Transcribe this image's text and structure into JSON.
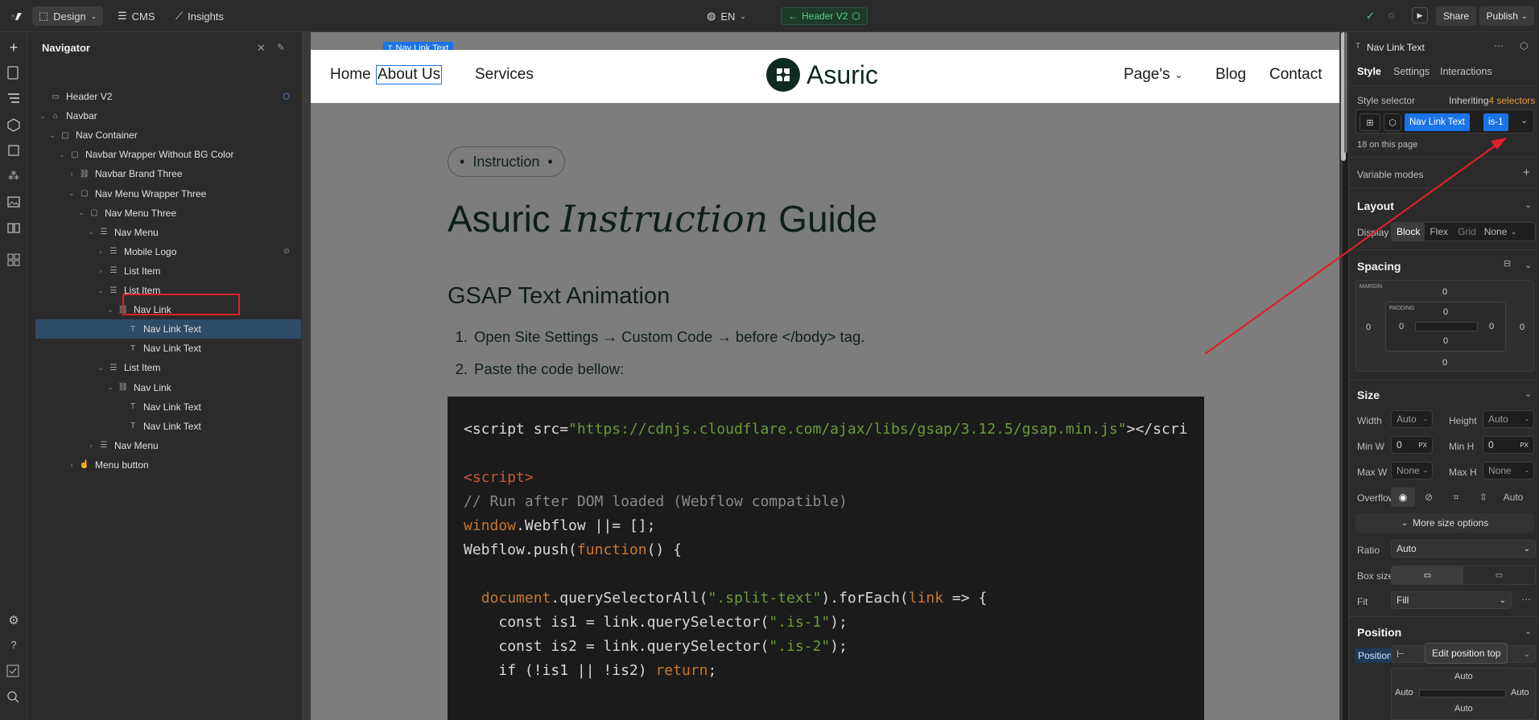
{
  "topbar": {
    "mode_tabs": [
      {
        "label": "Design",
        "active": true
      },
      {
        "label": "CMS",
        "active": false
      },
      {
        "label": "Insights",
        "active": false
      }
    ],
    "locale": "EN",
    "page_name": "Header V2",
    "share_label": "Share",
    "publish_label": "Publish"
  },
  "navigator": {
    "title": "Navigator",
    "tree": [
      {
        "label": "Header V2",
        "depth": 0,
        "icon": "page-icon"
      },
      {
        "label": "Navbar",
        "depth": 0,
        "icon": "home-icon",
        "expanded": true
      },
      {
        "label": "Nav Container",
        "depth": 1,
        "icon": "box-icon",
        "expanded": true
      },
      {
        "label": "Navbar Wrapper Without BG Color",
        "depth": 2,
        "icon": "box-icon",
        "expanded": true
      },
      {
        "label": "Navbar Brand Three",
        "depth": 3,
        "icon": "link-icon",
        "expanded": false
      },
      {
        "label": "Nav Menu Wrapper Three",
        "depth": 3,
        "icon": "box-icon",
        "expanded": true
      },
      {
        "label": "Nav Menu Three",
        "depth": 4,
        "icon": "box-icon",
        "expanded": true
      },
      {
        "label": "Nav Menu",
        "depth": 5,
        "icon": "list-icon",
        "expanded": true
      },
      {
        "label": "Mobile Logo",
        "depth": 6,
        "icon": "list-icon",
        "expanded": false
      },
      {
        "label": "List Item",
        "depth": 6,
        "icon": "list-icon",
        "expanded": false
      },
      {
        "label": "List Item",
        "depth": 6,
        "icon": "list-icon",
        "expanded": true
      },
      {
        "label": "Nav Link",
        "depth": 7,
        "icon": "link-icon",
        "expanded": true
      },
      {
        "label": "Nav Link Text",
        "depth": 8,
        "icon": "text-icon",
        "selected": true
      },
      {
        "label": "Nav Link Text",
        "depth": 8,
        "icon": "text-icon"
      },
      {
        "label": "List Item",
        "depth": 6,
        "icon": "list-icon",
        "expanded": true
      },
      {
        "label": "Nav Link",
        "depth": 7,
        "icon": "link-icon",
        "expanded": true
      },
      {
        "label": "Nav Link Text",
        "depth": 8,
        "icon": "text-icon"
      },
      {
        "label": "Nav Link Text",
        "depth": 8,
        "icon": "text-icon"
      },
      {
        "label": "Nav Menu",
        "depth": 5,
        "icon": "list-icon",
        "expanded": false
      },
      {
        "label": "Menu button",
        "depth": 3,
        "icon": "hand-icon",
        "expanded": false
      }
    ]
  },
  "canvas": {
    "selected_tag": "Nav Link Text",
    "site_nav": {
      "left_links": [
        "Home",
        "About Us",
        "Services"
      ],
      "brand": "Asuric",
      "right_links": [
        "Page's",
        "Blog",
        "Contact"
      ]
    },
    "pill": "Instruction",
    "heading_a": "Asuric",
    "heading_b": "Instruction",
    "heading_c": "Guide",
    "subheading": "GSAP Text Animation",
    "steps": [
      "Open Site Settings → Custom Code →  before </body> tag.",
      "Paste the code bellow:"
    ],
    "code": {
      "line1_tag": "<script src=",
      "line1_url": "\"https://cdnjs.cloudflare.com/ajax/libs/gsap/3.12.5/gsap.min.js\"",
      "line1_end": "></scri",
      "line2": "<script>",
      "line3": "// Run after DOM loaded (Webflow compatible)",
      "line4_a": "window",
      "line4_b": ".Webflow ||= [];",
      "line5_a": "Webflow.push(",
      "line5_b": "function",
      "line5_c": "() {",
      "line6_a": "document",
      "line6_b": ".querySelectorAll(",
      "line6_c": "\".split-text\"",
      "line6_d": ").forEach(",
      "line6_e": "link",
      "line6_f": " => {",
      "line7_a": "const is1 = link.querySelector(",
      "line7_b": "\".is-1\"",
      "line7_c": ");",
      "line8_a": "const is2 = link.querySelector(",
      "line8_b": "\".is-2\"",
      "line8_c": ");",
      "line9_a": "if (!is1 || !is2) ",
      "line9_b": "return",
      "line9_c": ";"
    }
  },
  "panel": {
    "element_name": "Nav Link Text",
    "tabs": [
      "Style",
      "Settings",
      "Interactions"
    ],
    "style_selector_label": "Style selector",
    "inheriting_label": "Inheriting",
    "selectors_count": "4 selectors",
    "class_chips": [
      "Nav Link Text",
      "is-1"
    ],
    "on_page": "18 on this page",
    "variable_modes": "Variable modes",
    "layout": {
      "title": "Layout",
      "display_label": "Display",
      "display_options": [
        "Block",
        "Flex",
        "Grid",
        "None"
      ]
    },
    "spacing": {
      "title": "Spacing",
      "margin_label": "MARGIN",
      "padding_label": "PADDING",
      "margin": {
        "top": "0",
        "right": "0",
        "bottom": "0",
        "left": "0"
      },
      "padding": {
        "top": "0",
        "right": "0",
        "bottom": "0",
        "left": "0"
      }
    },
    "size": {
      "title": "Size",
      "width_label": "Width",
      "width": "Auto",
      "height_label": "Height",
      "height": "Auto",
      "minw_label": "Min W",
      "minw": "0",
      "minh_label": "Min H",
      "minh": "0",
      "unit": "PX",
      "maxw_label": "Max W",
      "maxw": "None",
      "maxh_label": "Max H",
      "maxh": "None",
      "overflow_label": "Overflow",
      "overflow_auto": "Auto",
      "more_options": "More size options",
      "ratio_label": "Ratio",
      "ratio": "Auto",
      "boxsize_label": "Box size",
      "fit_label": "Fit",
      "fit": "Fill"
    },
    "position": {
      "title": "Position",
      "label": "Position",
      "tooltip": "Edit position top",
      "top": "Auto",
      "left": "Auto",
      "right": "Auto",
      "bottom": "Auto"
    }
  },
  "colors": {
    "accent_blue": "#1a73e8",
    "selection_blue": "#2f4c66",
    "annotation_red": "#e0202a",
    "brand_dark": "#0f2a22"
  }
}
